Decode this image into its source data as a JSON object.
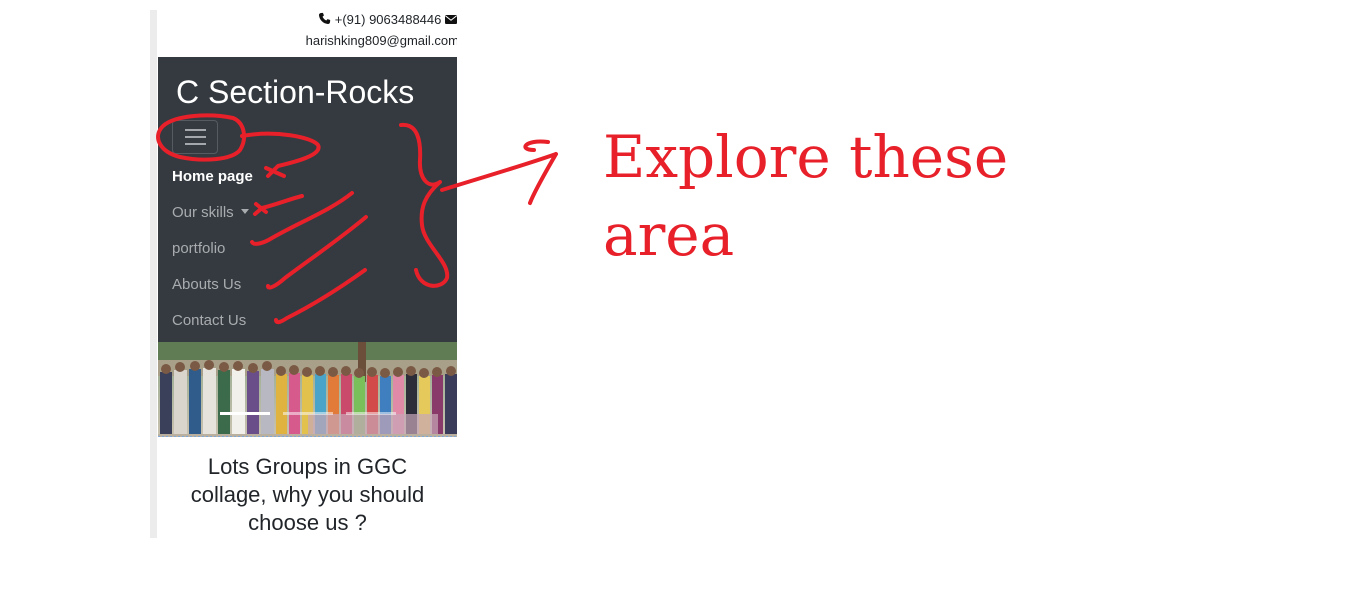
{
  "contact": {
    "phone_icon": "phone-icon",
    "phone": "+(91) 9063488446",
    "mail_icon": "envelope-icon",
    "email": "harishking809@gmail.com"
  },
  "navbar": {
    "brand": "C Section-Rocks",
    "toggler_icon": "hamburger-icon",
    "items": [
      {
        "label": "Home page",
        "active": true
      },
      {
        "label": "Our skills",
        "dropdown": true
      },
      {
        "label": "portfolio"
      },
      {
        "label": "Abouts Us"
      },
      {
        "label": "Contact Us"
      }
    ]
  },
  "carousel": {
    "image": "group-photo",
    "indicator_count": 3
  },
  "section": {
    "heading_line1": "Lots Groups in GGC",
    "heading_line2": "collage, why you should",
    "heading_line3": "choose us ?"
  },
  "annotation": {
    "line1": "Explore these",
    "line2": "area",
    "color": "#e8202a"
  },
  "colors": {
    "navbar_bg": "#343a40",
    "active_link": "#ffffff",
    "link": "#a9acaf",
    "accent": "#e8202a"
  }
}
